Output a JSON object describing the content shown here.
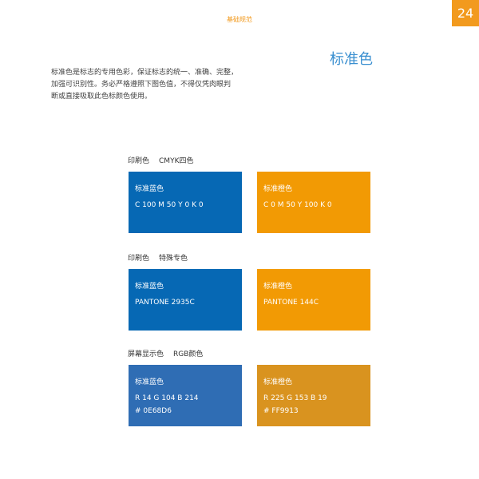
{
  "header": {
    "label": "基础规范",
    "page_number": "24"
  },
  "title": "标准色",
  "intro_lines": [
    "标准色是标志的专用色彩，保证标志的统一、准确、完整，",
    "加强可识别性。务必严格遵照下图色值，不得仅凭肉眼判",
    "断或直接吸取此色标颜色使用。"
  ],
  "groups": [
    {
      "label": "印刷色",
      "sublabel": "CMYK四色",
      "swatches": [
        {
          "name": "标准蓝色",
          "value": "C 100  M 50  Y 0  K 0",
          "hex": "",
          "color": "#0668b4"
        },
        {
          "name": "标准橙色",
          "value": "C 0  M 50  Y 100  K 0",
          "hex": "",
          "color": "#f29a04"
        }
      ]
    },
    {
      "label": "印刷色",
      "sublabel": "特殊专色",
      "swatches": [
        {
          "name": "标准蓝色",
          "value": "PANTONE 2935C",
          "hex": "",
          "color": "#0668b4"
        },
        {
          "name": "标准橙色",
          "value": "PANTONE 144C",
          "hex": "",
          "color": "#f29a04"
        }
      ]
    },
    {
      "label": "屏幕显示色",
      "sublabel": "RGB颜色",
      "swatches": [
        {
          "name": "标准蓝色",
          "value": "R 14    G 104    B 214",
          "hex": "# 0E68D6",
          "color": "#2f6db4"
        },
        {
          "name": "标准橙色",
          "value": "R 225    G 153    B 19",
          "hex": "# FF9913",
          "color": "#d9931f"
        }
      ]
    }
  ]
}
